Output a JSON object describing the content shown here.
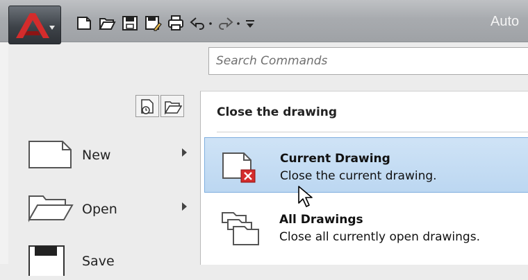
{
  "titlebar": {
    "title": "Auto",
    "icons": [
      "new-icon",
      "open-icon",
      "save-icon",
      "save-as-icon",
      "plot-icon",
      "undo-icon",
      "redo-icon",
      "customize-icon"
    ]
  },
  "app_button": {
    "icon": "autocad-logo-icon"
  },
  "search": {
    "placeholder": "Search Commands"
  },
  "menu": {
    "recent_buttons": [
      "recent-documents-icon",
      "open-documents-icon"
    ],
    "items": [
      {
        "label": "New",
        "icon": "new-document-icon",
        "has_submenu": true
      },
      {
        "label": "Open",
        "icon": "open-folder-icon",
        "has_submenu": true
      },
      {
        "label": "Save",
        "icon": "save-icon",
        "has_submenu": false
      }
    ]
  },
  "flyout": {
    "heading": "Close the drawing",
    "options": [
      {
        "title": "Current Drawing",
        "description": "Close the current drawing.",
        "icon": "close-current-drawing-icon",
        "highlighted": true
      },
      {
        "title": "All Drawings",
        "description": "Close all currently open drawings.",
        "icon": "close-all-drawings-icon",
        "highlighted": false
      }
    ]
  },
  "colors": {
    "accent_red": "#d42c2c",
    "highlight_blue": "#c4dcf3",
    "highlight_border": "#7eaede"
  }
}
